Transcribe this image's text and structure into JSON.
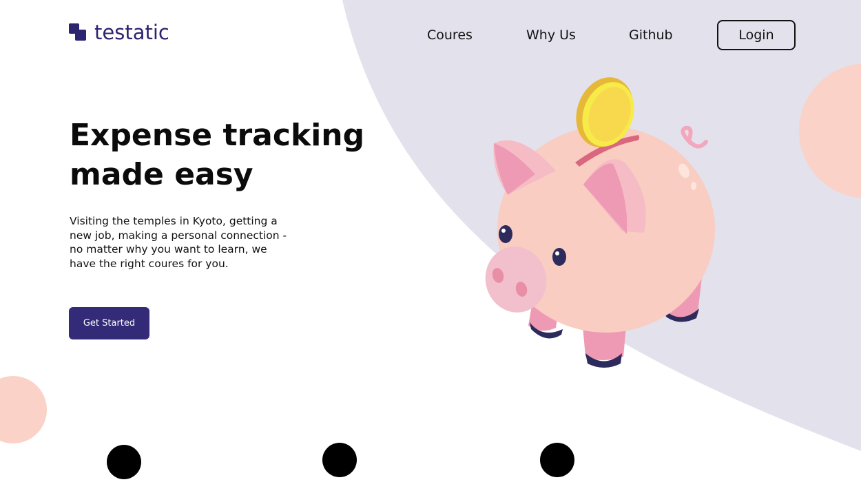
{
  "brand": {
    "name": "testatic"
  },
  "nav": {
    "items": [
      {
        "label": "Coures"
      },
      {
        "label": "Why Us"
      },
      {
        "label": "Github"
      }
    ],
    "login_label": "Login"
  },
  "hero": {
    "title_line1": "Expense tracking",
    "title_line2": "made easy",
    "description": "Visiting the temples in Kyoto, getting a new job, making a personal connection - no matter why you want to learn, we have the right coures for you.",
    "cta_label": "Get Started"
  },
  "illustration": {
    "name": "piggy-bank-with-coin"
  },
  "colors": {
    "brand_text": "#2d2470",
    "button": "#332a78",
    "background_blob": "#e3e1ec",
    "accent_peach": "#fbd2c7",
    "pig_body": "#f9cdc2",
    "pig_accent": "#ee9ab4",
    "coin": "#f8d94e"
  }
}
